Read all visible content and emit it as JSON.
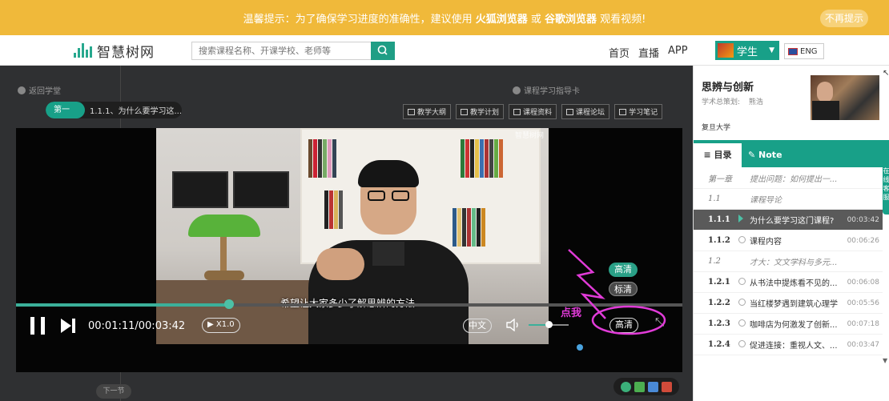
{
  "banner": {
    "prefix": "温馨提示：为了确保学习进度的准确性，建议使用 ",
    "browser1": "火狐浏览器",
    "or": " 或 ",
    "browser2": "谷歌浏览器",
    "suffix": " 观看视频!",
    "dismiss": "不再提示"
  },
  "header": {
    "logo": "智慧树网",
    "search_placeholder": "搜索课程名称、开课学校、老师等",
    "nav": [
      "首页",
      "直播",
      "APP"
    ],
    "role": "学生",
    "lang": "ENG"
  },
  "player": {
    "back": "返回学堂",
    "guide": "课程学习指导卡",
    "chapter": "第一章",
    "section_title": "1.1.1、为什么要学习这...",
    "tools": [
      "教学大纲",
      "教学计划",
      "课程资料",
      "课程论坛",
      "学习笔记"
    ],
    "watermark": "智慧树网",
    "subtitle": "希望让大家多少了解思辨的方法",
    "res_options": [
      "高清",
      "标清"
    ],
    "time": "00:01:11/00:03:42",
    "speed": "X1.0",
    "language": "中文",
    "quality": "高清",
    "next_section": "下一节",
    "progress": 0.32,
    "volume": 0.5
  },
  "annotation": {
    "click_me": "点我",
    "color": "#e13bd8"
  },
  "sidebar": {
    "course_title": "思辨与创新",
    "planner_label": "学术总策划:",
    "planner_name": "熊浩",
    "school": "复旦大学",
    "tab_toc": "目录",
    "tab_note": "Note",
    "side_tab": "在线客服",
    "toc": [
      {
        "num": "第一章",
        "label": "提出问题：如何提出一...",
        "dur": "",
        "type": "chapter"
      },
      {
        "num": "1.1",
        "label": "课程导论",
        "dur": "",
        "type": "section"
      },
      {
        "num": "1.1.1",
        "label": "为什么要学习这门课程?",
        "dur": "00:03:42",
        "type": "current"
      },
      {
        "num": "1.1.2",
        "label": "课程内容",
        "dur": "00:06:26",
        "type": "item"
      },
      {
        "num": "1.2",
        "label": "才大：文文学科与多元...",
        "dur": "",
        "type": "section"
      },
      {
        "num": "1.2.1",
        "label": "从书法中提炼看不见的...",
        "dur": "00:06:08",
        "type": "item"
      },
      {
        "num": "1.2.2",
        "label": "当红楼梦遇到建筑心理学",
        "dur": "00:05:56",
        "type": "item"
      },
      {
        "num": "1.2.3",
        "label": "咖啡店为何激发了创新...",
        "dur": "00:07:18",
        "type": "item"
      },
      {
        "num": "1.2.4",
        "label": "促进连接：重视人文、...",
        "dur": "00:03:47",
        "type": "item"
      }
    ]
  },
  "colors": {
    "accent": "#18a088",
    "banner": "#f0b93a"
  }
}
